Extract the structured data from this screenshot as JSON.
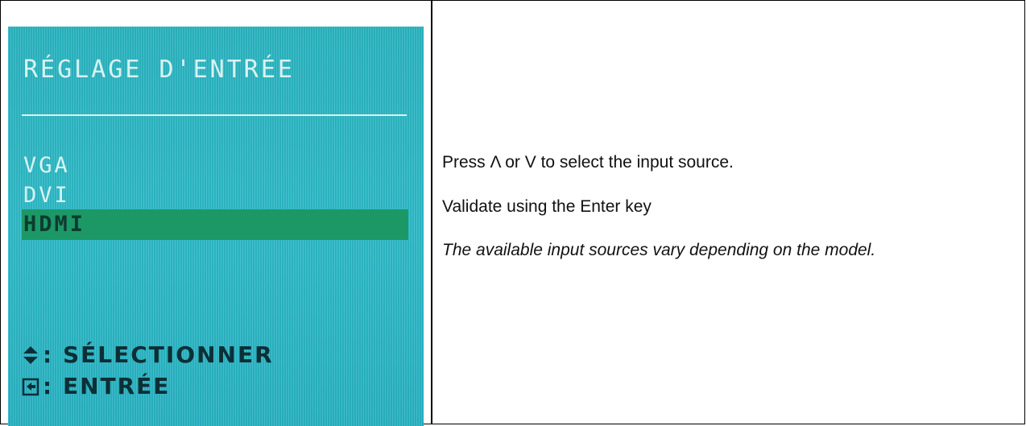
{
  "osd": {
    "title": "RÉGLAGE D'ENTRÉE",
    "options": [
      "VGA",
      "DVI",
      "HDMI"
    ],
    "selected_option": "HDMI",
    "hint_select": ": SÉLECTIONNER",
    "hint_enter": ": ENTRÉE",
    "colors": {
      "background": "#2fbcc9",
      "highlight": "#1c9866",
      "text": "#d9f3f2"
    }
  },
  "instructions": {
    "line1": "Press Λ or V to select the input source.",
    "line2": "Validate using the Enter key",
    "note": "The available input sources vary depending on the model."
  }
}
